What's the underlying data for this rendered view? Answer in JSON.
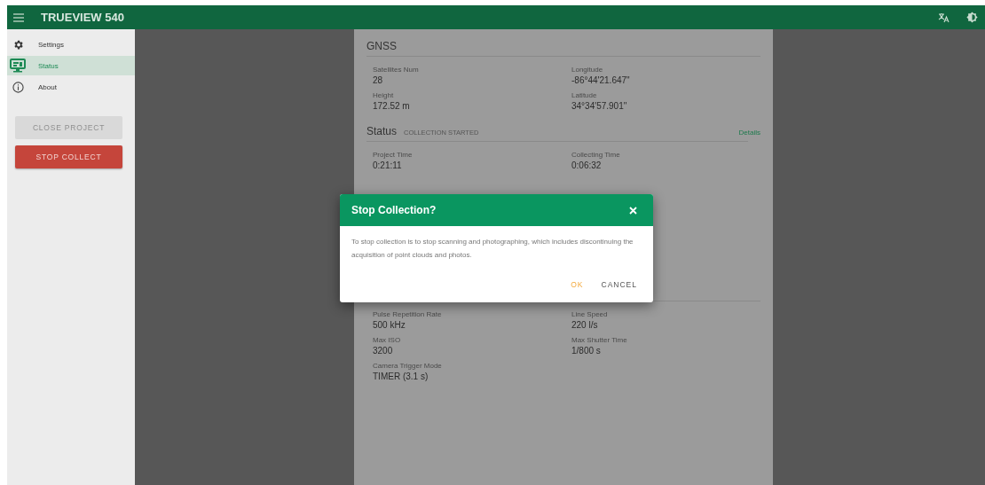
{
  "app_bar": {
    "title": "TRUEVIEW 540"
  },
  "sidebar": {
    "items": [
      {
        "label": "Settings",
        "selected": false
      },
      {
        "label": "Status",
        "selected": true
      },
      {
        "label": "About",
        "selected": false
      }
    ],
    "buttons": [
      {
        "label": "CLOSE PROJECT",
        "disabled": true
      },
      {
        "label": "STOP COLLECT",
        "disabled": false
      }
    ]
  },
  "sections": [
    {
      "title": "GNSS",
      "fields": [
        {
          "label": "Satellites Num",
          "value": "28"
        },
        {
          "label": "Longitude",
          "value": "-86°44'21.647\""
        },
        {
          "label": "Height",
          "value": "172.52 m"
        },
        {
          "label": "Latitude",
          "value": "34°34'57.901\""
        }
      ]
    },
    {
      "title": "Status",
      "subtitle": "COLLECTION STARTED",
      "link": "Details",
      "fields": [
        {
          "label": "Project Time",
          "value": "0:21:11"
        },
        {
          "label": "Collecting Time",
          "value": "0:06:32"
        }
      ]
    },
    {
      "fields": [
        {
          "label": "Pulse Repetition Rate",
          "value": "500 kHz"
        },
        {
          "label": "Line Speed",
          "value": "220 l/s"
        },
        {
          "label": "Max ISO",
          "value": "3200"
        },
        {
          "label": "Max Shutter Time",
          "value": "1/800 s"
        },
        {
          "label": "Camera Trigger Mode",
          "value": "TIMER (3.1 s)"
        }
      ]
    }
  ],
  "dialog": {
    "title": "Stop Collection?",
    "message": "To stop collection is to stop scanning and photographing, which includes discontinuing the acquisition of point clouds and photos.",
    "buttons": [
      {
        "label": "OK",
        "kind": "primary"
      },
      {
        "label": "CANCEL",
        "kind": "secondary"
      }
    ]
  }
}
